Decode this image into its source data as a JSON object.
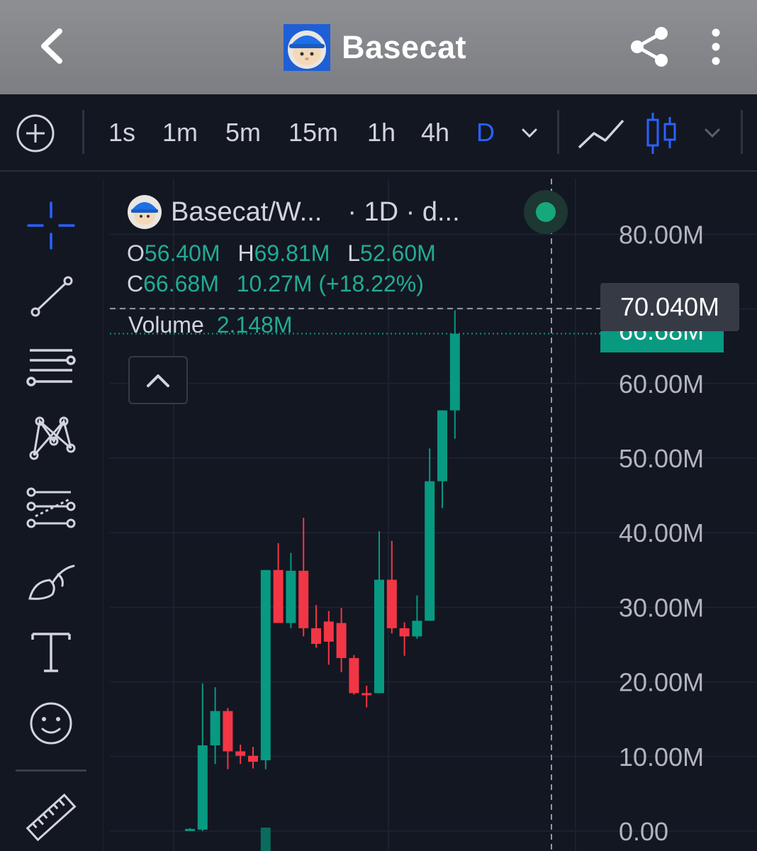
{
  "app": {
    "title": "Basecat",
    "avatar_icon": "hard-hat-cat-avatar",
    "back_icon": "chevron-left-icon",
    "share_icon": "share-icon",
    "more_icon": "more-vertical-icon"
  },
  "toolbar": {
    "add_icon": "plus-circle-icon",
    "timeframes": [
      "1s",
      "1m",
      "5m",
      "15m",
      "1h",
      "4h",
      "D"
    ],
    "active_timeframe": "D",
    "line_chart_icon": "line-chart-icon",
    "candle_chart_icon": "candlestick-icon",
    "active_style": "candles"
  },
  "tools": [
    "crosshair-icon",
    "trend-line-icon",
    "horizontal-lines-icon",
    "pattern-icon",
    "projection-icon",
    "brush-icon",
    "text-icon",
    "emoji-icon",
    "ruler-icon"
  ],
  "legend": {
    "symbol": "Basecat/W...",
    "interval": "· 1D · d...",
    "o_label": "O",
    "o": "56.40M",
    "h_label": "H",
    "h": "69.81M",
    "l_label": "L",
    "l": "52.60M",
    "c_label": "C",
    "c": "66.68M",
    "change": "10.27M (+18.22%)",
    "volume_label": "Volume",
    "volume": "2.148M"
  },
  "crosshair_price": "70.040M",
  "last_price": "66.68M",
  "colors": {
    "up": "#089981",
    "down": "#f23645",
    "accent": "#2962ff",
    "background": "#131722"
  },
  "chart_data": {
    "type": "candlestick",
    "y_tick_labels": [
      "80.00M",
      "60.00M",
      "50.00M",
      "40.00M",
      "30.00M",
      "20.00M",
      "10.00M",
      "0.00"
    ],
    "ylim": [
      0,
      80
    ],
    "y_unit": "M",
    "grid": true,
    "candles": [
      {
        "o": 0.3,
        "h": 0.4,
        "l": 0.2,
        "c": 0.3
      },
      {
        "o": 0.2,
        "h": 19.8,
        "l": 0.0,
        "c": 11.5
      },
      {
        "o": 11.5,
        "h": 19.3,
        "l": 9.0,
        "c": 16.1
      },
      {
        "o": 16.1,
        "h": 16.5,
        "l": 8.3,
        "c": 10.7
      },
      {
        "o": 10.7,
        "h": 11.6,
        "l": 9.0,
        "c": 10.1
      },
      {
        "o": 10.1,
        "h": 11.3,
        "l": 8.4,
        "c": 9.3
      },
      {
        "o": 9.5,
        "h": 11.0,
        "l": 8.3,
        "c": 35.0
      },
      {
        "o": 35.0,
        "h": 38.6,
        "l": 28.7,
        "c": 27.9
      },
      {
        "o": 27.9,
        "h": 37.3,
        "l": 27.2,
        "c": 34.9
      },
      {
        "o": 34.9,
        "h": 42.0,
        "l": 26.1,
        "c": 27.2
      },
      {
        "o": 27.2,
        "h": 30.3,
        "l": 24.6,
        "c": 25.1
      },
      {
        "o": 28.1,
        "h": 29.5,
        "l": 22.3,
        "c": 25.4
      },
      {
        "o": 27.9,
        "h": 29.9,
        "l": 21.3,
        "c": 23.2
      },
      {
        "o": 23.2,
        "h": 23.6,
        "l": 18.3,
        "c": 18.5
      },
      {
        "o": 18.5,
        "h": 19.5,
        "l": 16.6,
        "c": 18.4
      },
      {
        "o": 18.5,
        "h": 40.2,
        "l": 18.5,
        "c": 33.7
      },
      {
        "o": 33.7,
        "h": 38.9,
        "l": 26.5,
        "c": 27.2
      },
      {
        "o": 27.2,
        "h": 28.0,
        "l": 23.5,
        "c": 26.1
      },
      {
        "o": 26.1,
        "h": 31.6,
        "l": 25.8,
        "c": 28.2
      },
      {
        "o": 28.2,
        "h": 51.3,
        "l": 28.2,
        "c": 46.9
      },
      {
        "o": 46.9,
        "h": 56.4,
        "l": 43.3,
        "c": 56.4
      },
      {
        "o": 56.4,
        "h": 69.81,
        "l": 52.6,
        "c": 66.68
      }
    ],
    "volume_bars": [
      2.148
    ]
  }
}
